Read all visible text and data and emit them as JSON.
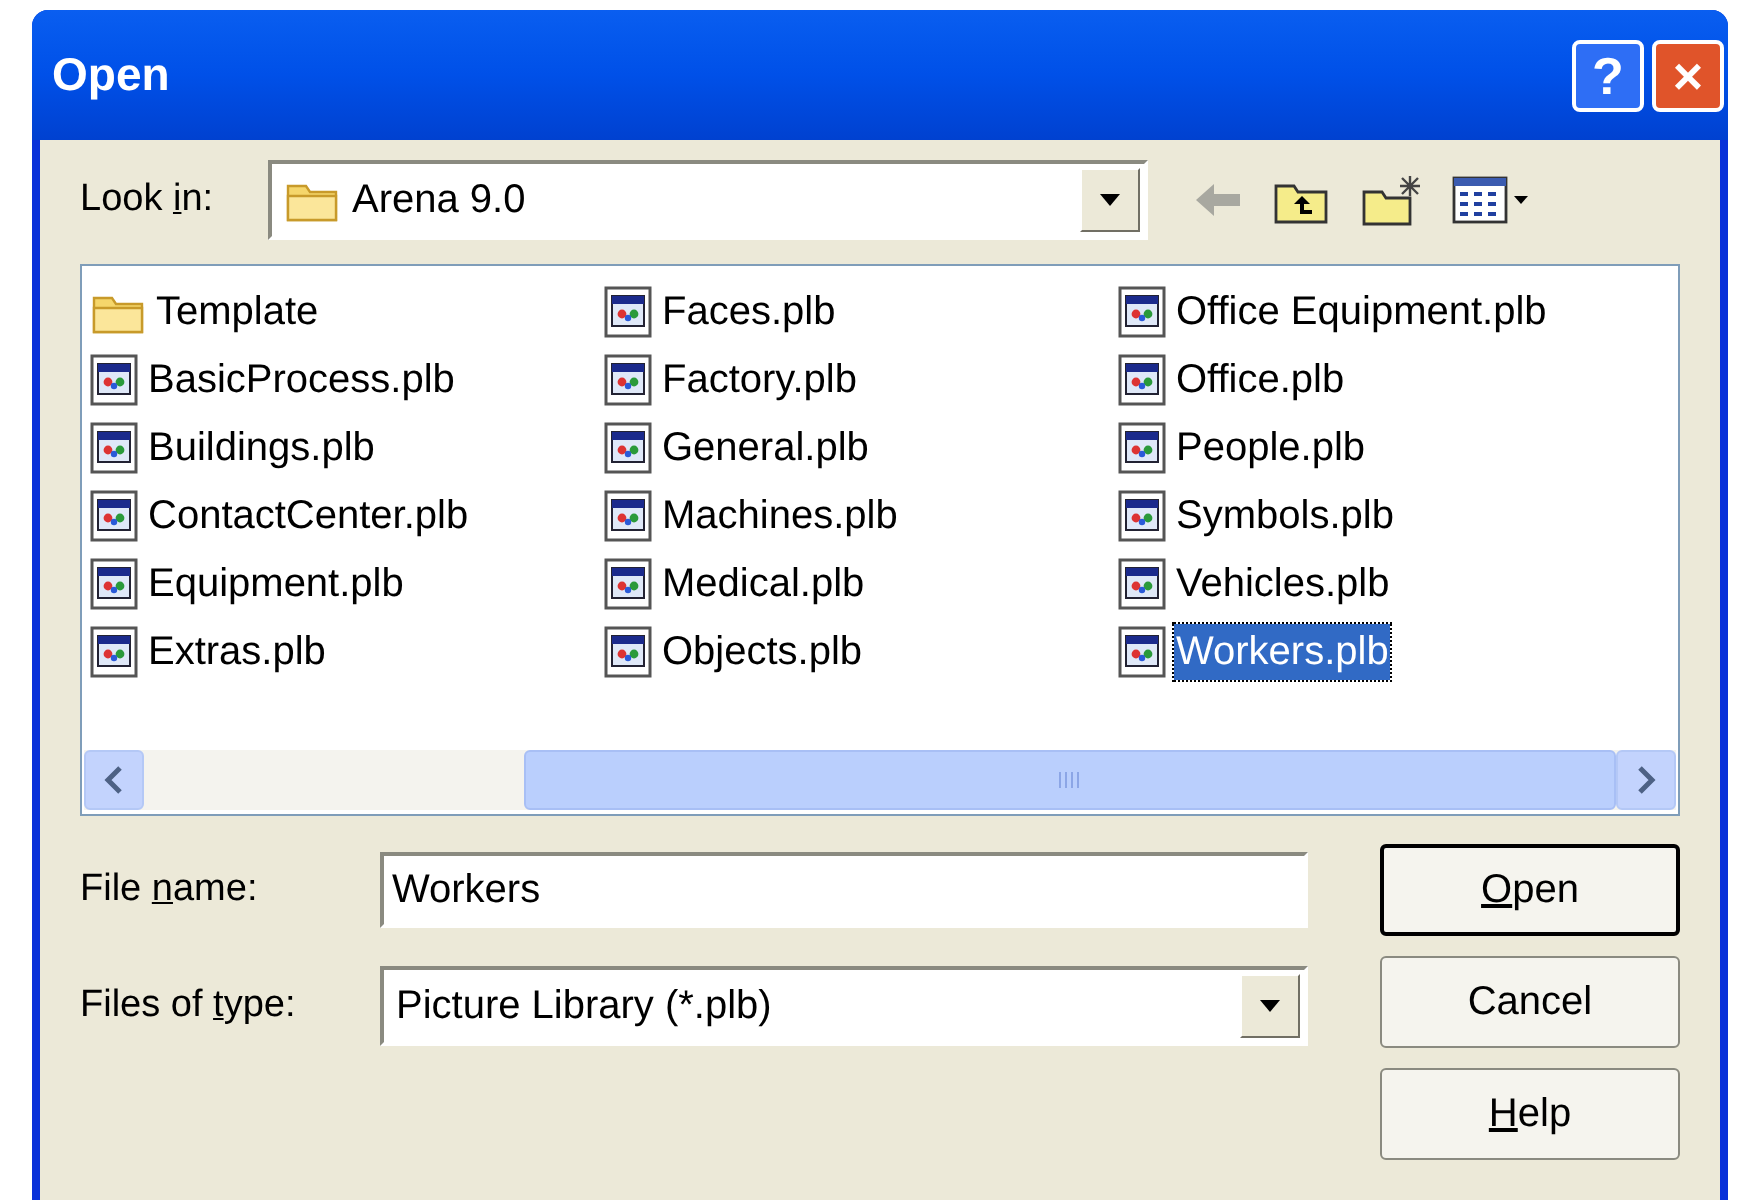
{
  "window": {
    "title": "Open",
    "title_buttons": [
      "?",
      "×"
    ]
  },
  "look_in": {
    "label": {
      "before": "Look ",
      "access_key": "i",
      "after": "n:"
    },
    "value": "Arena 9.0"
  },
  "files": [
    {
      "name": "Template",
      "kind": "folder",
      "selected": false
    },
    {
      "name": "BasicProcess.plb",
      "kind": "file",
      "selected": false
    },
    {
      "name": "Buildings.plb",
      "kind": "file",
      "selected": false
    },
    {
      "name": "ContactCenter.plb",
      "kind": "file",
      "selected": false
    },
    {
      "name": "Equipment.plb",
      "kind": "file",
      "selected": false
    },
    {
      "name": "Extras.plb",
      "kind": "file",
      "selected": false
    },
    {
      "name": "Faces.plb",
      "kind": "file",
      "selected": false
    },
    {
      "name": "Factory.plb",
      "kind": "file",
      "selected": false
    },
    {
      "name": "General.plb",
      "kind": "file",
      "selected": false
    },
    {
      "name": "Machines.plb",
      "kind": "file",
      "selected": false
    },
    {
      "name": "Medical.plb",
      "kind": "file",
      "selected": false
    },
    {
      "name": "Objects.plb",
      "kind": "file",
      "selected": false
    },
    {
      "name": "Office Equipment.plb",
      "kind": "file",
      "selected": false
    },
    {
      "name": "Office.plb",
      "kind": "file",
      "selected": false
    },
    {
      "name": "People.plb",
      "kind": "file",
      "selected": false
    },
    {
      "name": "Symbols.plb",
      "kind": "file",
      "selected": false
    },
    {
      "name": "Vehicles.plb",
      "kind": "file",
      "selected": false
    },
    {
      "name": "Workers.plb",
      "kind": "file",
      "selected": true
    }
  ],
  "file_name": {
    "label": {
      "before": "File ",
      "access_key": "n",
      "after": "ame:"
    },
    "value": "Workers"
  },
  "file_type": {
    "label": {
      "before": "Files of ",
      "access_key": "t",
      "after": "ype:"
    },
    "value": "Picture Library (*.plb)"
  },
  "buttons": [
    {
      "label": {
        "access_key": "O",
        "after": "pen"
      },
      "default": true
    },
    {
      "label": {
        "before": "Cancel"
      },
      "default": false
    },
    {
      "label": {
        "access_key": "H",
        "after": "elp"
      },
      "default": false
    }
  ]
}
